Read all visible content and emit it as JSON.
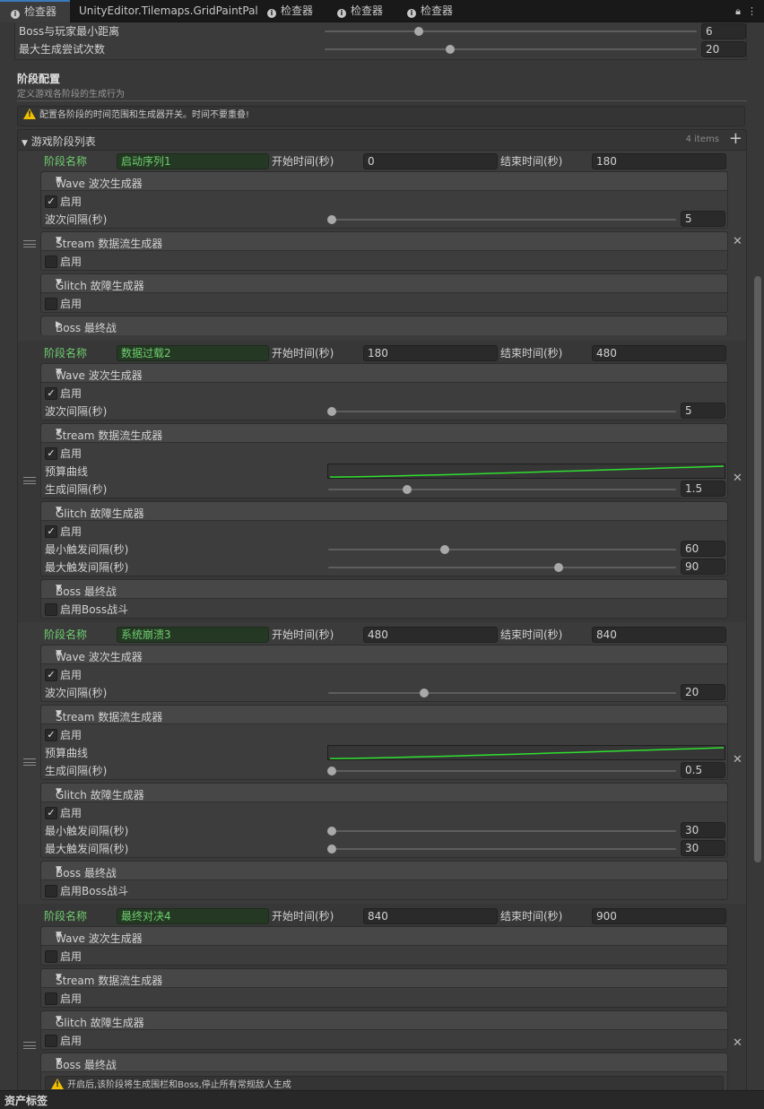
{
  "tabs": [
    {
      "label": "检查器",
      "icon": "info-icon"
    },
    {
      "label": "UnityEditor.Tilemaps.GridPaintPalet",
      "icon": ""
    },
    {
      "label": "检查器",
      "icon": "info-icon"
    },
    {
      "label": "检查器",
      "icon": "info-icon"
    },
    {
      "label": "检查器",
      "icon": "info-icon"
    }
  ],
  "top_fields": [
    {
      "label": "Boss与玩家最小距离",
      "value": "6",
      "slider_fraction": 0.25
    },
    {
      "label": "最大生成尝试次数",
      "value": "20",
      "slider_fraction": 0.34
    }
  ],
  "section": {
    "title": "阶段配置",
    "subtitle": "定义游戏各阶段的生成行为",
    "help": "配置各阶段的时间范围和生成器开关。时间不要重叠!"
  },
  "list": {
    "title": "游戏阶段列表",
    "count": "4 items"
  },
  "labels": {
    "phase_name": "阶段名称",
    "start_time": "开始时间(秒)",
    "end_time": "结束时间(秒)",
    "enable": "启用",
    "wave_interval": "波次间隔(秒)",
    "budget_curve": "预算曲线",
    "spawn_interval": "生成间隔(秒)",
    "min_trigger": "最小触发间隔(秒)",
    "max_trigger": "最大触发间隔(秒)",
    "enable_boss": "启用Boss战斗"
  },
  "generators": {
    "wave": "Wave 波次生成器",
    "stream": "Stream 数据流生成器",
    "glitch": "Glitch 故障生成器",
    "boss": "Boss 最终战"
  },
  "phases": [
    {
      "name": "启动序列1",
      "start": "0",
      "end": "180",
      "wave": {
        "enabled": true,
        "interval": "5",
        "interval_fraction": 0.0
      },
      "stream": {
        "enabled": false
      },
      "glitch": {
        "enabled": false
      },
      "boss": {
        "expanded": false
      }
    },
    {
      "name": "数据过载2",
      "start": "180",
      "end": "480",
      "wave": {
        "enabled": true,
        "interval": "5",
        "interval_fraction": 0.0
      },
      "stream": {
        "enabled": true,
        "interval": "1.5",
        "interval_fraction": 0.23
      },
      "glitch": {
        "enabled": true,
        "min": "60",
        "min_fraction": 0.34,
        "max": "90",
        "max_fraction": 0.66
      },
      "boss": {
        "expanded": true,
        "enabled": false
      }
    },
    {
      "name": "系统崩溃3",
      "start": "480",
      "end": "840",
      "wave": {
        "enabled": true,
        "interval": "20",
        "interval_fraction": 0.28
      },
      "stream": {
        "enabled": true,
        "interval": "0.5",
        "interval_fraction": 0.0
      },
      "glitch": {
        "enabled": true,
        "min": "30",
        "min_fraction": 0.0,
        "max": "30",
        "max_fraction": 0.0
      },
      "boss": {
        "expanded": true,
        "enabled": false
      }
    },
    {
      "name": "最终对决4",
      "start": "840",
      "end": "900",
      "wave": {
        "enabled": false
      },
      "stream": {
        "enabled": false
      },
      "glitch": {
        "enabled": false
      },
      "boss": {
        "expanded": true,
        "help": "开启后,该阶段将生成围栏和Boss,停止所有常规敌人生成"
      }
    }
  ],
  "bottom_bar": "资产标签",
  "colors": {
    "accent_green": "#6fcf6f",
    "curve_green": "#2fe02f",
    "warning_yellow": "#f0c000",
    "active_tab": "#3a79bb"
  }
}
